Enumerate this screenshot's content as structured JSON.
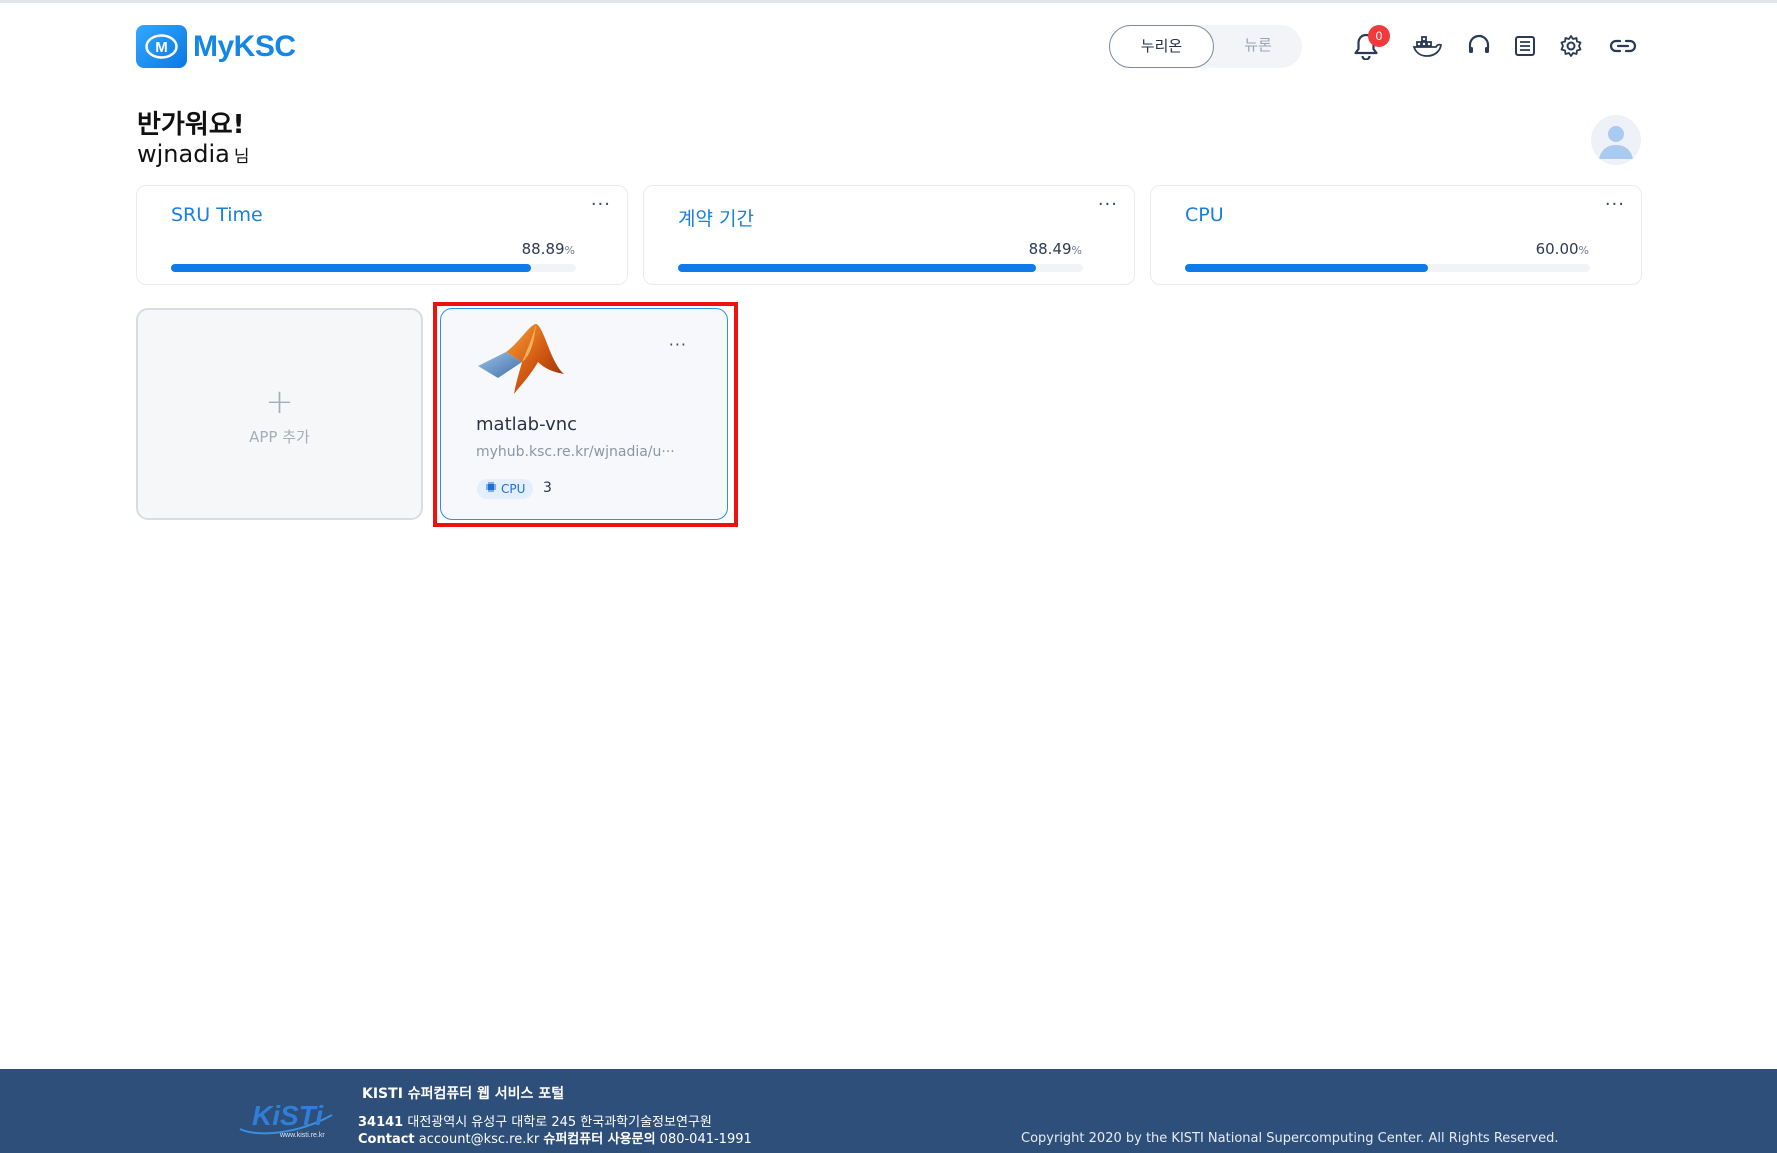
{
  "app": {
    "brand": "MyKSC"
  },
  "header": {
    "toggle_options": [
      "누리온",
      "뉴론"
    ],
    "notification_count": "0",
    "icons": [
      "bell-icon",
      "docker-icon",
      "headset-icon",
      "document-icon",
      "gear-icon",
      "link-icon"
    ]
  },
  "greeting": {
    "line1": "반가워요!",
    "username": "wjnadia",
    "suffix": "님"
  },
  "stats": [
    {
      "title": "SRU Time",
      "value": "88.89",
      "unit": "%",
      "progress": 88.89,
      "more": "···"
    },
    {
      "title": "계약 기간",
      "value": "88.49",
      "unit": "%",
      "progress": 88.49,
      "more": "···"
    },
    {
      "title": "CPU",
      "value": "60.00",
      "unit": "%",
      "progress": 60.0,
      "more": "···"
    }
  ],
  "apps": {
    "add_label": "APP 추가",
    "add_symbol": "+",
    "items": [
      {
        "name": "matlab-vnc",
        "url": "myhub.ksc.re.kr/wjnadia/u···",
        "resource": "CPU",
        "count": "3",
        "more": "···",
        "icon": "matlab-icon"
      }
    ]
  },
  "footer": {
    "logo_sub": "www.kisti.re.kr",
    "title": "KISTI 슈퍼컴퓨터 웹 서비스 포털",
    "postcode": "34141",
    "address": "대전광역시 유성구 대학로 245 한국과학기술정보연구원",
    "contact_label": "Contact",
    "email": "account@ksc.re.kr",
    "support_label": "슈퍼컴퓨터 사용문의",
    "phone": "080-041-1991",
    "copyright": "Copyright 2020 by the KISTI National Supercomputing Center. All Rights Reserved."
  },
  "colors": {
    "accent": "#0e7be8",
    "highlight": "#ee1111",
    "footer_bg": "#2e4f7a",
    "badge": "#f2393b"
  }
}
